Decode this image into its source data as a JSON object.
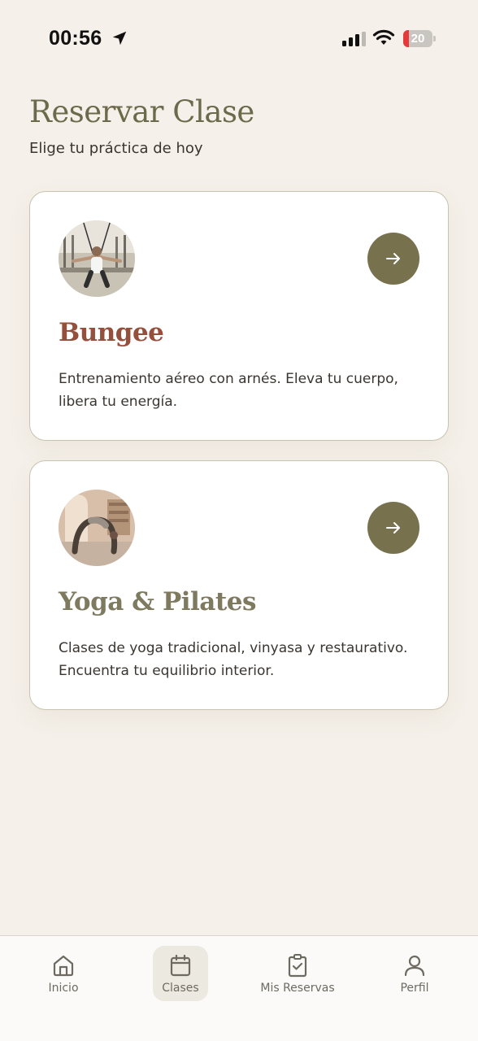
{
  "status_bar": {
    "time": "00:56",
    "battery_level": "20",
    "battery_fraction": 0.2,
    "icons": [
      "location-arrow-icon",
      "signal-icon",
      "wifi-icon",
      "battery-icon"
    ]
  },
  "header": {
    "title": "Reservar Clase",
    "subtitle": "Elige tu práctica de hoy"
  },
  "classes": [
    {
      "title": "Bungee",
      "description": "Entrenamiento aéreo con arnés. Eleva tu cuerpo, libera tu energía.",
      "image": "bungee-class-photo",
      "action_icon": "arrow-right-icon"
    },
    {
      "title": "Yoga & Pilates",
      "description": "Clases de yoga tradicional, vinyasa y restaurativo. Encuentra tu equilibrio interior.",
      "image": "yoga-class-photo",
      "action_icon": "arrow-right-icon"
    }
  ],
  "bottom_nav": {
    "items": [
      {
        "label": "Inicio",
        "icon": "home-icon",
        "active": false
      },
      {
        "label": "Clases",
        "icon": "calendar-icon",
        "active": true
      },
      {
        "label": "Mis Reservas",
        "icon": "clipboard-check-icon",
        "active": false
      },
      {
        "label": "Perfil",
        "icon": "user-icon",
        "active": false
      }
    ]
  },
  "colors": {
    "background": "#f5f0e9",
    "accent": "#77714d",
    "title_olive": "#6d6a4c",
    "bungee_title": "#94503c",
    "card_border": "#c8c4b0"
  }
}
